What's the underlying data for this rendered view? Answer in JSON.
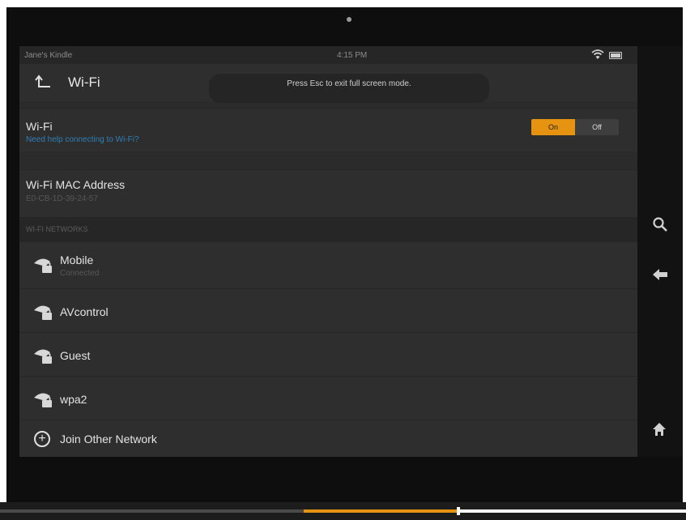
{
  "status_bar": {
    "device_name": "Jane's Kindle",
    "time": "4:15 PM"
  },
  "header": {
    "title": "Wi-Fi",
    "toast": "Press Esc to exit full screen mode."
  },
  "wifi_toggle": {
    "label": "Wi-Fi",
    "help_link": "Need help connecting to Wi-Fi?",
    "on_label": "On",
    "off_label": "Off",
    "selected": "On"
  },
  "mac": {
    "label": "Wi-Fi MAC Address",
    "value": "E0-CB-1D-39-24-57"
  },
  "networks": {
    "section_title": "WI-FI NETWORKS",
    "items": [
      {
        "name": "Mobile",
        "status": "Connected"
      },
      {
        "name": "AVcontrol",
        "status": ""
      },
      {
        "name": "Guest",
        "status": ""
      },
      {
        "name": "wpa2",
        "status": ""
      }
    ],
    "join_label": "Join Other Network"
  },
  "side_rail": {
    "icons": [
      "search-icon",
      "back-arrow-icon",
      "home-icon"
    ]
  },
  "video_progress": 0.67,
  "colors": {
    "accent": "#e69311",
    "link": "#2f7fb5",
    "screen_bg": "#2b2b2b"
  }
}
